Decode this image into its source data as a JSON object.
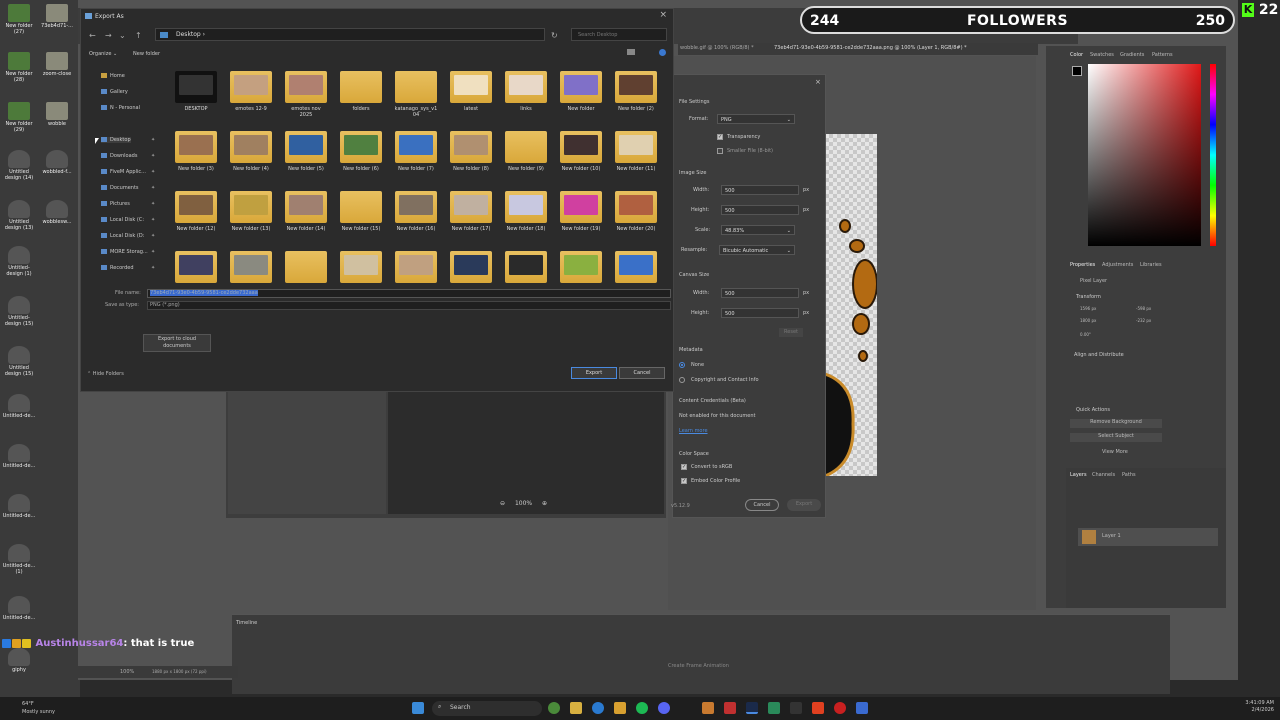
{
  "overlay": {
    "followers_label": "FOLLOWERS",
    "followers_current": "244",
    "followers_goal": "250",
    "kick_count": "22"
  },
  "desktop_icons": [
    {
      "label": "New folder\n(27)"
    },
    {
      "label": "73eb4d71-..."
    },
    {
      "label": "New folder\n(28)"
    },
    {
      "label": "zoom-close"
    },
    {
      "label": "New folder\n(29)"
    },
    {
      "label": "wobble"
    },
    {
      "label": "Untitled\ndesign (14)"
    },
    {
      "label": "wobbled-f..."
    },
    {
      "label": "Untitled\ndesign (13)"
    },
    {
      "label": "wobblesw..."
    },
    {
      "label": "Untitled-\ndesign (1)"
    },
    {
      "label": "Untitled-\ndesign (15)"
    },
    {
      "label": "Untitled\ndesign (15)"
    },
    {
      "label": "Untitled-de..."
    },
    {
      "label": "Untitled-de..."
    },
    {
      "label": "Untitled-de..."
    },
    {
      "label": "Untitled-de...\n(1)"
    },
    {
      "label": "Untitled-de..."
    },
    {
      "label": "giphy"
    }
  ],
  "ps": {
    "tabs": [
      "wobble.gif @ 100% (RGB/8) *",
      "73eb4d71-93e0-4b59-9581-ce2dde732aaa.png @ 100% (Layer 1, RGB/8#) *"
    ],
    "panel_tabs_top": [
      "Color",
      "Swatches",
      "Gradients",
      "Patterns"
    ],
    "panel_tabs_mid": [
      "Properties",
      "Adjustments",
      "Libraries"
    ],
    "pixel_layer": "Pixel Layer",
    "transform_label": "Transform",
    "w_value": "1596 px",
    "x_value": "-598 px",
    "h_value": "1800 px",
    "y_value": "-232 px",
    "angle_value": "0.00°",
    "align_label": "Align and Distribute",
    "quick_actions": "Quick Actions",
    "remove_bg": "Remove Background",
    "select_subject": "Select Subject",
    "view_more": "View More",
    "layers_tabs": [
      "Layers",
      "Channels",
      "Paths"
    ],
    "layer_name": "Layer 1",
    "timeline_label": "Timeline",
    "create_timeline": "Create Frame Animation",
    "zoom_status": "100%",
    "doc_status": "1880 px x 1800 px (72 ppi)"
  },
  "export_dialog": {
    "title": "Export As",
    "path": "Desktop",
    "search_placeholder": "Search Desktop",
    "organize": "Organize",
    "new_folder": "New folder",
    "nav": [
      {
        "label": "Home",
        "pinned": false
      },
      {
        "label": "Gallery",
        "pinned": false
      },
      {
        "label": "N - Personal",
        "pinned": false
      },
      {
        "label": "Desktop",
        "pinned": true
      },
      {
        "label": "Downloads",
        "pinned": true
      },
      {
        "label": "FiveM Applic...",
        "pinned": true
      },
      {
        "label": "Documents",
        "pinned": true
      },
      {
        "label": "Pictures",
        "pinned": true
      },
      {
        "label": "Local Disk (C:",
        "pinned": true
      },
      {
        "label": "Local Disk (D:",
        "pinned": true
      },
      {
        "label": "MORE Storag...",
        "pinned": true
      },
      {
        "label": "Recorded",
        "pinned": true
      }
    ],
    "files": [
      "DESKTOP",
      "emotes 12-9",
      "emotes nov\n2025",
      "folders",
      "katanago_sys_v1\n04",
      "latest",
      "links",
      "New folder",
      "New folder (2)",
      "New folder (3)",
      "New folder (4)",
      "New folder (5)",
      "New folder (6)",
      "New folder (7)",
      "New folder (8)",
      "New folder (9)",
      "New folder (10)",
      "New folder (11)",
      "New folder (12)",
      "New folder (13)",
      "New folder (14)",
      "New folder (15)",
      "New folder (16)",
      "New folder (17)",
      "New folder (18)",
      "New folder (19)",
      "New folder (20)",
      "",
      "",
      "",
      "",
      "",
      "",
      "",
      "",
      ""
    ],
    "file_name_label": "File name:",
    "file_name_value": "73eb4d71-93e0-4b59-9581-ce2dde732aaa",
    "save_type_label": "Save as type:",
    "save_type_value": "PNG (*.png)",
    "export_clouds": "Export to cloud\ndocuments",
    "hide_folders": "Hide Folders",
    "export_btn": "Export",
    "cancel_btn": "Cancel"
  },
  "settings": {
    "file_settings": "File Settings",
    "format_label": "Format:",
    "format_value": "PNG",
    "transparency": "Transparency",
    "smaller_file": "Smaller File (8-bit)",
    "image_size": "Image Size",
    "width_label": "Width:",
    "width_value": "500",
    "height_label": "Height:",
    "height_value": "500",
    "scale_label": "Scale:",
    "scale_value": "48.83%",
    "resample_label": "Resample:",
    "resample_value": "Bicubic Automatic",
    "canvas_size": "Canvas Size",
    "canvas_w_label": "Width:",
    "canvas_w_value": "500",
    "canvas_h_label": "Height:",
    "canvas_h_value": "500",
    "px": "px",
    "reset": "Reset",
    "metadata": "Metadata",
    "meta_none": "None",
    "meta_copyright": "Copyright and Contact Info",
    "content_credentials": "Content Credentials (Beta)",
    "not_enabled": "Not enabled for this document",
    "learn_more": "Learn more",
    "color_space": "Color Space",
    "convert_srgb": "Convert to sRGB",
    "embed_profile": "Embed Color Profile",
    "version": "v5.12.9",
    "cancel": "Cancel",
    "export": "Export",
    "zoom": "100%"
  },
  "chat": {
    "user": "Austinhussar64",
    "message": ": that is true"
  },
  "taskbar": {
    "temp": "64°F",
    "weather": "Mostly sunny",
    "search": "Search",
    "time": "3:41:09 AM",
    "date": "2/4/2026"
  }
}
